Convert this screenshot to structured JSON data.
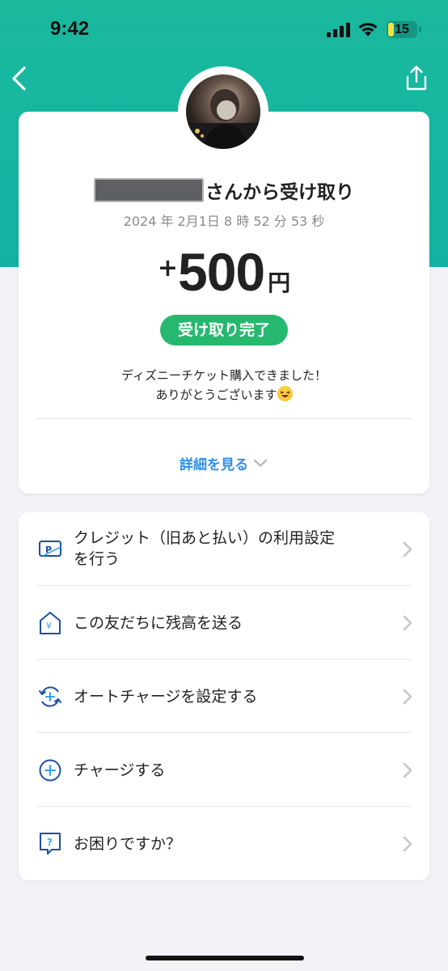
{
  "status_bar": {
    "time": "9:42",
    "battery": "15",
    "icons": [
      "signal-icon",
      "wifi-icon",
      "battery-icon"
    ]
  },
  "nav": {
    "back_icon": "chevron-left-icon",
    "share_icon": "share-icon"
  },
  "transaction": {
    "sender_suffix": "さんから受け取り",
    "timestamp": "2024 年 2月1日  8 時 52 分 53 秒",
    "amount_sign": "+",
    "amount": "500",
    "currency": "円",
    "status": "受け取り完了",
    "message_line1": "ディズニーチケット購入できました！",
    "message_line2": "ありがとうございます",
    "details_label": "詳細を見る"
  },
  "colors": {
    "header": "#1ab99e",
    "status_pill": "#27b870",
    "link": "#2f8ee8",
    "icon_blue": "#1d4fa0"
  },
  "menu": {
    "items": [
      {
        "label_line1": "クレジット（旧あと払い）の利用設定",
        "label_line2": "を行う",
        "icon": "credit-card-icon"
      },
      {
        "label_line1": "この友だちに残高を送る",
        "icon": "yen-house-icon"
      },
      {
        "label_line1": "オートチャージを設定する",
        "icon": "auto-charge-icon"
      },
      {
        "label_line1": "チャージする",
        "icon": "plus-circle-icon"
      },
      {
        "label_line1": "お困りですか？",
        "icon": "help-bubble-icon"
      }
    ]
  }
}
